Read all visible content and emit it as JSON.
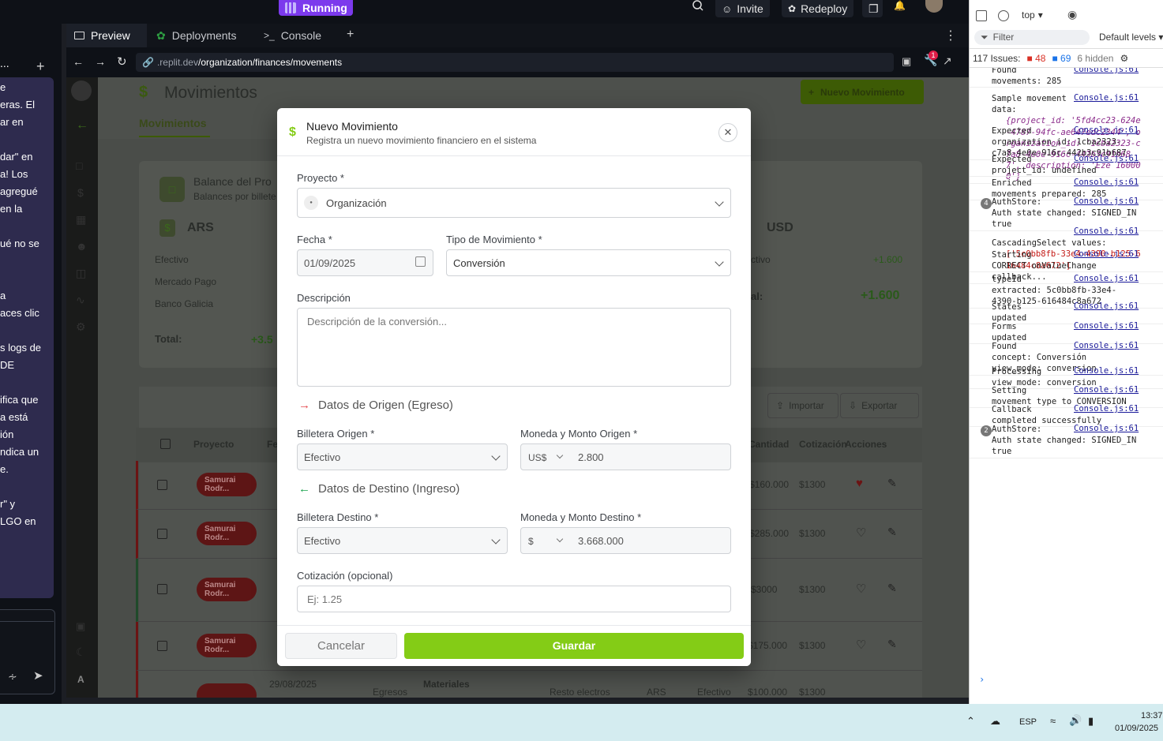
{
  "topbar": {
    "status": "Running",
    "invite": "Invite",
    "redeploy": "Redeploy"
  },
  "chat": {
    "lines": [
      "e",
      "eras. El",
      "ar en",
      "",
      "dar\" en",
      "a! Los",
      "agregué",
      "en la",
      "",
      "ué no se",
      "",
      "",
      "a",
      "aces clic",
      "",
      "s logs de",
      "DE",
      "",
      "ifica que",
      "a está",
      "ión",
      "ndica un",
      "e.",
      "",
      "r\" y",
      "LGO en"
    ]
  },
  "tabs": [
    {
      "label": "Preview"
    },
    {
      "label": "Deployments"
    },
    {
      "label": "Console"
    }
  ],
  "url": {
    "prefix": ".replit.dev",
    "path": "/organization/finances/movements"
  },
  "app": {
    "page_title": "Movimientos",
    "new_button": "Nuevo Movimiento",
    "tab": "Movimientos",
    "balance": {
      "title": "Balance del Pro",
      "subtitle": "Balances por billete",
      "ars": "ARS",
      "usd": "USD",
      "rows": [
        "Efectivo",
        "Mercado Pago",
        "Banco Galicia"
      ],
      "total_label": "Total:",
      "total_value": "+3.5",
      "usd_row": "ctivo",
      "usd_row_value": "+1.600",
      "usd_total_label": "al:",
      "usd_total": "+1.600"
    },
    "actions": {
      "import": "Importar",
      "export": "Exportar"
    },
    "table": {
      "headers": [
        "Proyecto",
        "Fe",
        "Cantidad",
        "Cotización",
        "Acciones"
      ],
      "rows": [
        {
          "name": "Samurai Rodr...",
          "amount": "$160.000",
          "rate": "$1300"
        },
        {
          "name": "Samurai Rodr...",
          "amount": "$285.000",
          "rate": "$1300"
        },
        {
          "name": "Samurai Rodr...",
          "amount": "$3000",
          "rate": "$1300"
        },
        {
          "name": "Samurai Rodr...",
          "amount": "$175.000",
          "rate": "$1300"
        }
      ],
      "last_row": {
        "date": "29/08/2025",
        "type": "Egresos",
        "cat": "Materiales",
        "desc": "Resto electros",
        "cur": "ARS",
        "wallet": "Efectivo",
        "amount": "$100.000",
        "rate": "$1300"
      }
    }
  },
  "modal": {
    "title": "Nuevo Movimiento",
    "subtitle": "Registra un nuevo movimiento financiero en el sistema",
    "project_label": "Proyecto *",
    "project_value": "Organización",
    "date_label": "Fecha *",
    "date_value": "01/09/2025",
    "type_label": "Tipo de Movimiento *",
    "type_value": "Conversión",
    "desc_label": "Descripción",
    "desc_placeholder": "Descripción de la conversión...",
    "origin_section": "Datos de Origen (Egreso)",
    "origin_wallet_label": "Billetera Origen *",
    "origin_wallet": "Efectivo",
    "origin_amount_label": "Moneda y Monto Origen *",
    "origin_currency": "US$",
    "origin_amount": "2.800",
    "dest_section": "Datos de Destino (Ingreso)",
    "dest_wallet_label": "Billetera Destino *",
    "dest_wallet": "Efectivo",
    "dest_amount_label": "Moneda y Monto Destino *",
    "dest_currency": "$",
    "dest_amount": "3.668.000",
    "rate_label": "Cotización (opcional)",
    "rate_placeholder": "Ej: 1.25",
    "cancel": "Cancelar",
    "save": "Guardar"
  },
  "devtools": {
    "context": "top",
    "filter": "Filter",
    "levels": "Default levels",
    "issues": "117 Issues:",
    "errors": "48",
    "warnings": "69",
    "hidden": "6 hidden",
    "source": "Console.js:61",
    "entries": [
      {
        "text": [
          "Found",
          "movements: 285"
        ]
      },
      {
        "text": [
          "Sample movement",
          "data:",
          "{project_id: '5fd4cc23-624e",
          "-4787-94fc-ae647edc2344', o",
          "rganization_id: '1cba2323-c",
          "7a8-4e0e-916c-442b3c91b68",
          "7', description: 'Eze 16000",
          "0'}"
        ]
      },
      {
        "text": [
          "Expected",
          "organization_id: 1cba2323-",
          "c7a8-4e0e-916c-442b3c91b687"
        ]
      },
      {
        "text": [
          "Expected",
          "project_id: undefined"
        ]
      },
      {
        "text": [
          "Enriched",
          "movements prepared: 285"
        ]
      },
      {
        "text": [
          "AuthStore:",
          "Auth state changed: SIGNED_IN",
          "true"
        ],
        "count": "4"
      },
      {
        "text": [
          "",
          "CascadingSelect values:",
          "['5c0bb8fb-33e4-4390-b125-6",
          "16484c8a672']"
        ]
      },
      {
        "text": [
          "Starting",
          "CORRECT onValueChange",
          "callback..."
        ]
      },
      {
        "text": [
          "typeId",
          "extracted: 5c0bb8fb-33e4-",
          "4390-b125-616484c8a672"
        ]
      },
      {
        "text": [
          "States",
          "updated"
        ]
      },
      {
        "text": [
          "Forms",
          "updated"
        ]
      },
      {
        "text": [
          "Found",
          "concept: Conversión",
          "view_mode: conversion"
        ]
      },
      {
        "text": [
          "Processing",
          "view_mode: conversion"
        ]
      },
      {
        "text": [
          "Setting",
          "movement type to CONVERSION"
        ]
      },
      {
        "text": [
          "Callback",
          "completed successfully"
        ]
      },
      {
        "text": [
          "AuthStore:",
          "Auth state changed: SIGNED_IN",
          "true"
        ],
        "count": "2"
      }
    ]
  },
  "taskbar": {
    "lang": "ESP",
    "time": "13:37",
    "date": "01/09/2025"
  }
}
